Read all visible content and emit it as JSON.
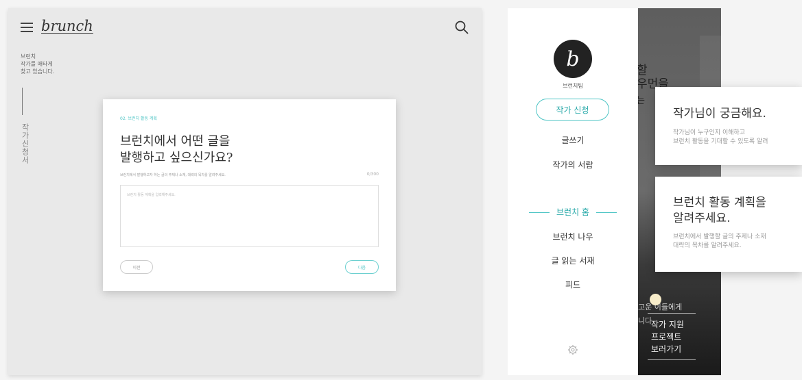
{
  "left": {
    "logo": "brunch",
    "tagline": "브런치\n작가를 애타게\n찾고 있습니다.",
    "vertical_label": "작가신청서",
    "modal": {
      "step": "02. 브런치 활동 계획",
      "question": "브런치에서 어떤 글을\n발행하고 싶으신가요?",
      "hint": "브런치에서 발행하고자 하는 글의 주제나 소재, 대략의 목차를 알려주세요.",
      "count": "0/300",
      "placeholder": "브런치 활동 계획을 입력해주세요.",
      "prev_label": "이전",
      "next_label": "다음"
    }
  },
  "right": {
    "profile_name": "브런치팀",
    "apply_label": "작가 신청",
    "menu_top": [
      "글쓰기",
      "작가의 서랍"
    ],
    "active_label": "브런치 홈",
    "menu_bottom": [
      "브런치 나우",
      "글 읽는 서재",
      "피드"
    ],
    "bg_text_1": "할",
    "bg_text_2": "우먼을",
    "bg_text_3": "는",
    "card1": {
      "title": "작가님이 궁금해요.",
      "desc": "작가님이 누구인지 이해하고\n브런치 활동을 기대할 수 있도록 알려"
    },
    "card2": {
      "title": "브런치 활동 계획을\n알려주세요.",
      "desc": "브런치에서 발행할 글의 주제나 소재\n대략의 목차를 알려주세요."
    },
    "bottom_text_1": "고운 이들에게",
    "bottom_text_2": "니다",
    "link_label": "작가 지원\n프로젝트\n보러가기"
  },
  "colors": {
    "accent": "#4cc4c4"
  }
}
